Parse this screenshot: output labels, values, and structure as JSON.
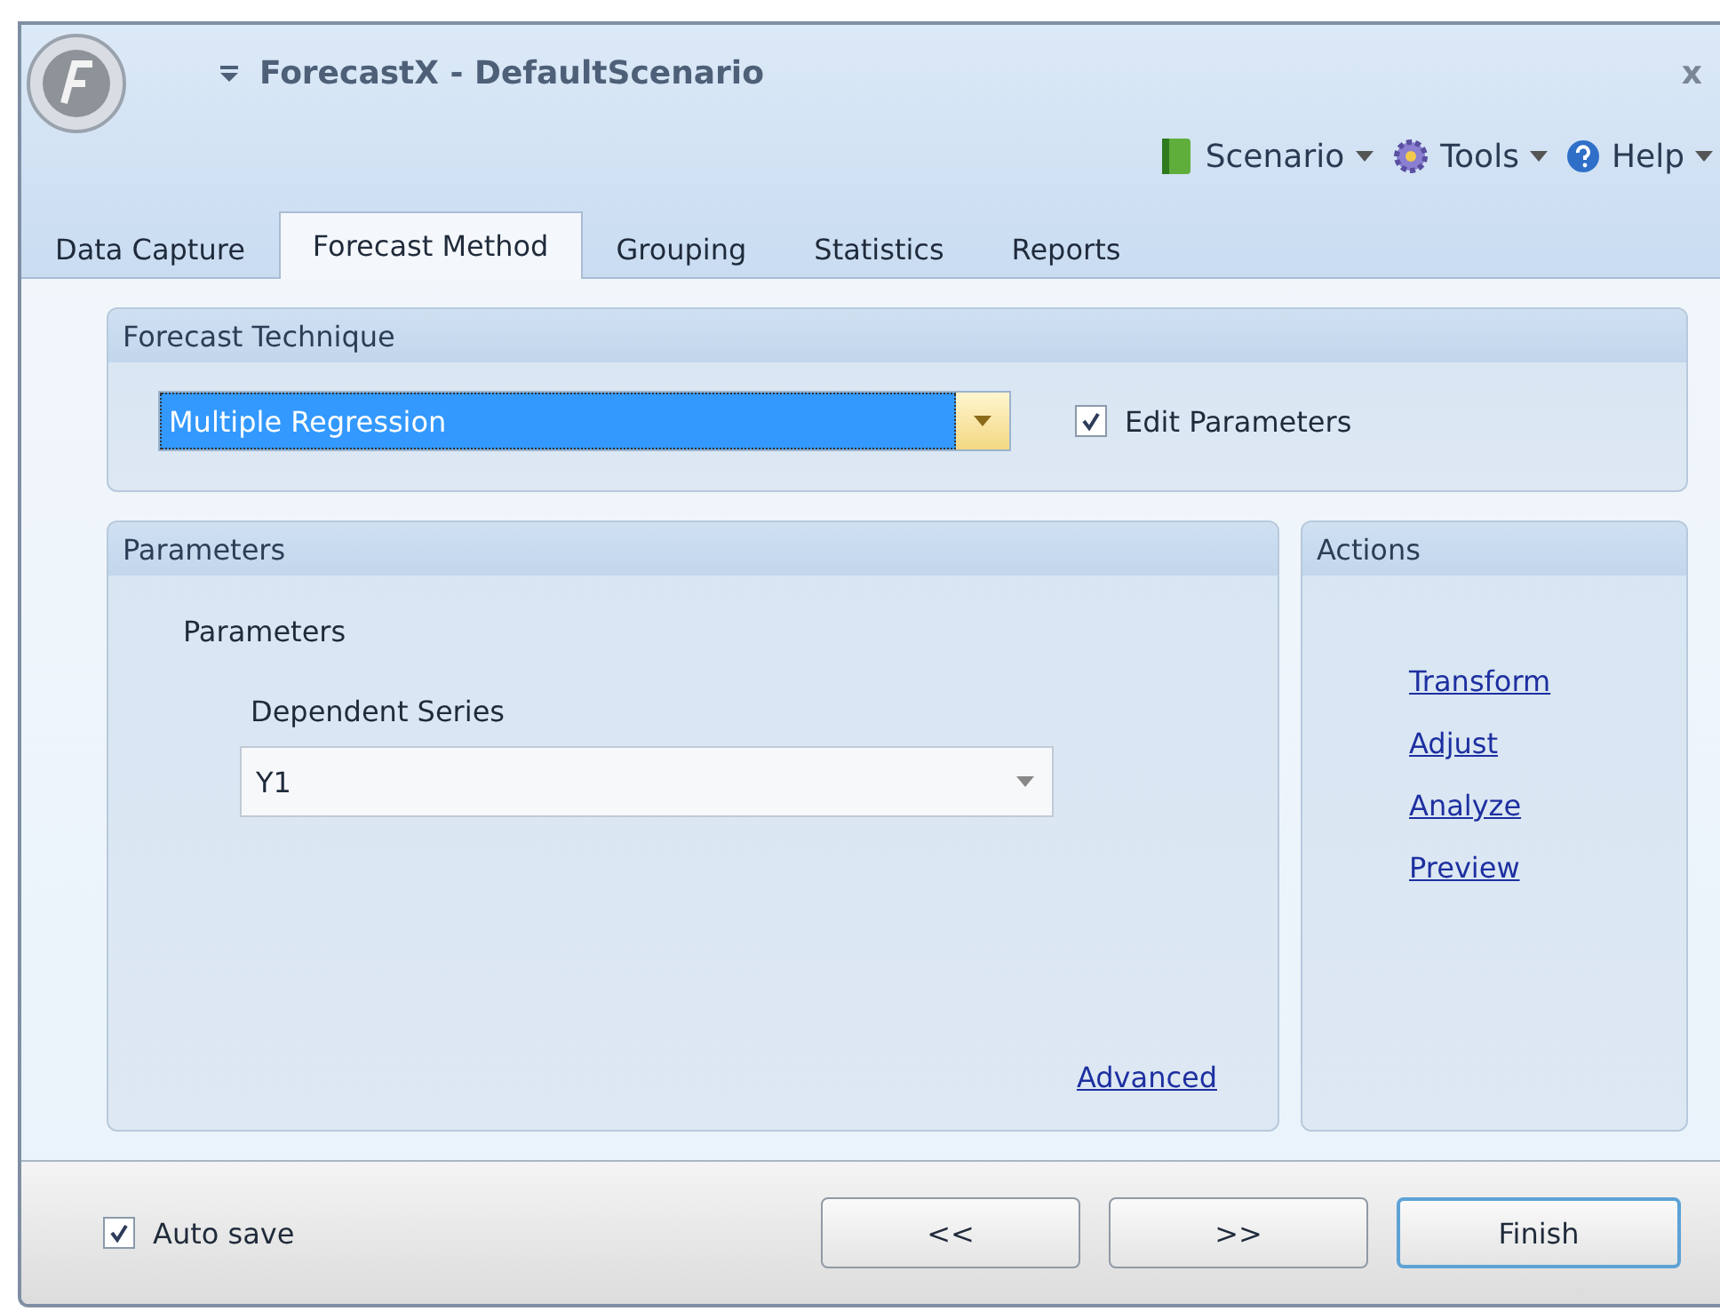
{
  "window": {
    "title": "ForecastX - DefaultScenario",
    "close": "x"
  },
  "menu": [
    {
      "label": "Scenario"
    },
    {
      "label": "Tools"
    },
    {
      "label": "Help"
    }
  ],
  "tabs": [
    {
      "label": "Data Capture",
      "selected": false
    },
    {
      "label": "Forecast Method",
      "selected": true
    },
    {
      "label": "Grouping",
      "selected": false
    },
    {
      "label": "Statistics",
      "selected": false
    },
    {
      "label": "Reports",
      "selected": false
    }
  ],
  "technique": {
    "title": "Forecast Technique",
    "value": "Multiple Regression",
    "edit_parameters": {
      "label": "Edit Parameters",
      "checked": true
    }
  },
  "parameters": {
    "title": "Parameters",
    "group_title": "Parameters",
    "dependent_label": "Dependent Series",
    "dependent_value": "Y1",
    "advanced": "Advanced"
  },
  "actions": {
    "title": "Actions",
    "links": [
      "Transform",
      "Adjust",
      "Analyze",
      "Preview"
    ]
  },
  "footer": {
    "auto_save": {
      "label": "Auto save",
      "checked": true
    },
    "buttons": [
      {
        "label": "<<",
        "default": false
      },
      {
        "label": ">>",
        "default": false
      },
      {
        "label": "Finish",
        "default": true
      }
    ]
  }
}
